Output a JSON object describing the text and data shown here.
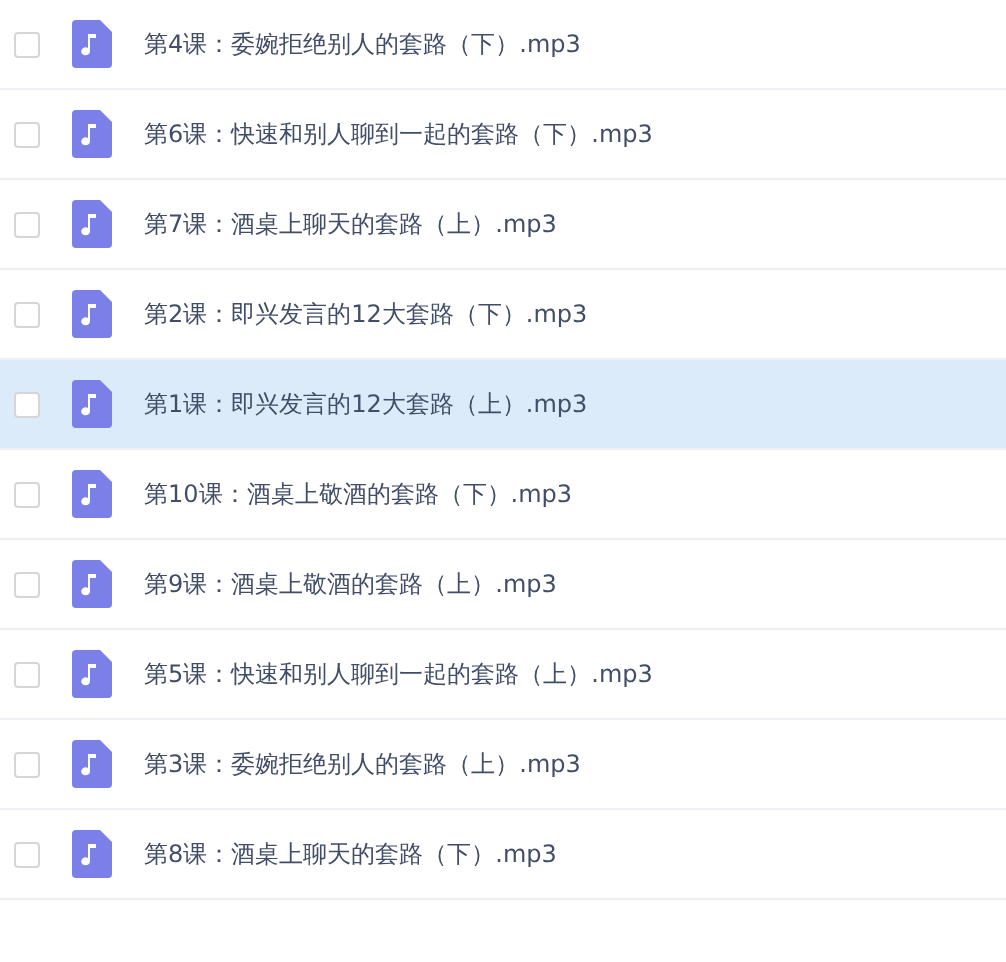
{
  "files": [
    {
      "name": "第4课：委婉拒绝别人的套路（下）.mp3",
      "checked": false,
      "highlighted": false
    },
    {
      "name": "第6课：快速和别人聊到一起的套路（下）.mp3",
      "checked": false,
      "highlighted": false
    },
    {
      "name": "第7课：酒桌上聊天的套路（上）.mp3",
      "checked": false,
      "highlighted": false
    },
    {
      "name": "第2课：即兴发言的12大套路（下）.mp3",
      "checked": false,
      "highlighted": false
    },
    {
      "name": "第1课：即兴发言的12大套路（上）.mp3",
      "checked": false,
      "highlighted": true
    },
    {
      "name": "第10课：酒桌上敬酒的套路（下）.mp3",
      "checked": false,
      "highlighted": false
    },
    {
      "name": "第9课：酒桌上敬酒的套路（上）.mp3",
      "checked": false,
      "highlighted": false
    },
    {
      "name": "第5课：快速和别人聊到一起的套路（上）.mp3",
      "checked": false,
      "highlighted": false
    },
    {
      "name": "第3课：委婉拒绝别人的套路（上）.mp3",
      "checked": false,
      "highlighted": false
    },
    {
      "name": "第8课：酒桌上聊天的套路（下）.mp3",
      "checked": false,
      "highlighted": false
    }
  ]
}
